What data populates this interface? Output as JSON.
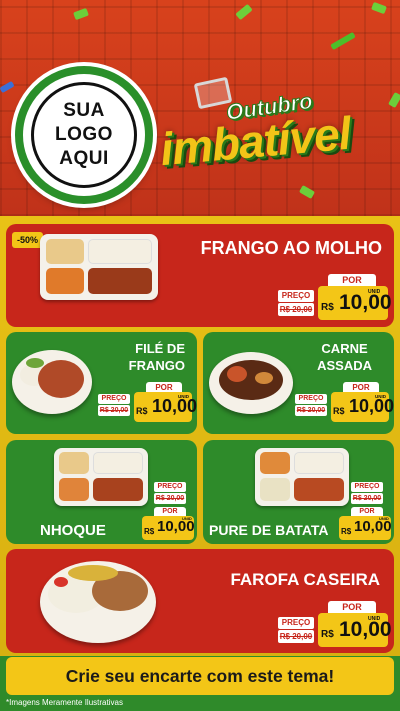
{
  "header": {
    "logo_lines": [
      "SUA",
      "LOGO",
      "AQUI"
    ],
    "title_top": "Outubro",
    "title_main": "imbatível"
  },
  "products": [
    {
      "name_lines": [
        "FRANGO AO MOLHO"
      ],
      "discount": "-50%",
      "preco_label": "PREÇO",
      "old_price": "R$ 20,00",
      "por_label": "POR",
      "currency": "R$",
      "price": "10,00",
      "unit": "UNID"
    },
    {
      "name_lines": [
        "FILÉ DE",
        "FRANGO"
      ],
      "preco_label": "PREÇO",
      "old_price": "R$ 20,00",
      "por_label": "POR",
      "currency": "R$",
      "price": "10,00",
      "unit": "UNID"
    },
    {
      "name_lines": [
        "CARNE",
        "ASSADA"
      ],
      "preco_label": "PREÇO",
      "old_price": "R$ 20,00",
      "por_label": "POR",
      "currency": "R$",
      "price": "10,00",
      "unit": "UNID"
    },
    {
      "name_lines": [
        "NHOQUE"
      ],
      "preco_label": "PREÇO",
      "old_price": "R$ 20,00",
      "por_label": "POR",
      "currency": "R$",
      "price": "10,00",
      "unit": "UNID"
    },
    {
      "name_lines": [
        "PURE DE BATATA"
      ],
      "preco_label": "PREÇO",
      "old_price": "R$ 20,00",
      "por_label": "POR",
      "currency": "R$",
      "price": "10,00",
      "unit": "UNID"
    },
    {
      "name_lines": [
        "FAROFA CASEIRA"
      ],
      "preco_label": "PREÇO",
      "old_price": "R$ 20,00",
      "por_label": "POR",
      "currency": "R$",
      "price": "10,00",
      "unit": "UNID"
    }
  ],
  "footer": {
    "cta": "Crie seu encarte com este tema!",
    "note": "*Imagens Meramente Ilustrativas"
  },
  "colors": {
    "red": "#c7261b",
    "green": "#2e8b2a",
    "yellow": "#f3c617"
  }
}
